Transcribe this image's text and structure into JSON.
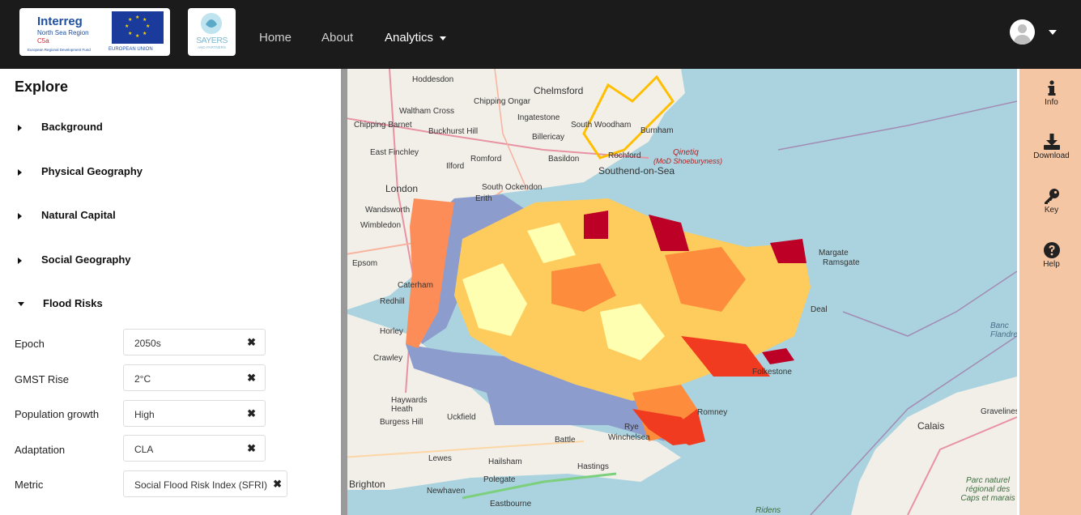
{
  "header": {
    "logo_interreg": {
      "title": "Interreg",
      "subtitle": "North Sea Region",
      "tag": "C5a",
      "fund": "European Regional Development Fund",
      "eu": "EUROPEAN UNION"
    },
    "logo_sayers": {
      "title": "SAYERS",
      "subtitle": "AND PARTNERS"
    },
    "nav": {
      "home": "Home",
      "about": "About",
      "analytics": "Analytics"
    }
  },
  "sidebar": {
    "title": "Explore",
    "sections": [
      "Background",
      "Physical Geography",
      "Natural Capital",
      "Social Geography",
      "Flood Risks"
    ],
    "filters": [
      {
        "label": "Epoch",
        "value": "2050s"
      },
      {
        "label": "GMST Rise",
        "value": "2°C"
      },
      {
        "label": "Population growth",
        "value": "High"
      },
      {
        "label": "Adaptation",
        "value": "CLA"
      },
      {
        "label": "Metric",
        "value": "Social Flood Risk Index (SFRI)"
      }
    ],
    "clear_glyph": "✖"
  },
  "map": {
    "labels": [
      "Hoddesdon",
      "Chelmsford",
      "Waltham Cross",
      "Chipping Ongar",
      "Ingatestone",
      "Chipping Barnet",
      "Buckhurst Hill",
      "South Woodham",
      "Burnham",
      "Billericay",
      "East Finchley",
      "Ilford",
      "Romford",
      "Basildon",
      "Rochford",
      "Qinetiq",
      "(MoD Shoeburyness)",
      "Southend-on-Sea",
      "London",
      "South Ockendon",
      "Erith",
      "Wandsworth",
      "Wimbledon",
      "Epsom",
      "Caterham",
      "Redhill",
      "Horley",
      "Crawley",
      "Haywards Heath",
      "Burgess Hill",
      "Uckfield",
      "Battle",
      "Winchelsea",
      "Rye",
      "Lewes",
      "Hailsham",
      "Hastings",
      "Polegate",
      "Newhaven",
      "Eastbourne",
      "Brighton",
      "Calais",
      "Gravelines",
      "Banc Flandre",
      "Parc naturel régional des Caps et marais",
      "Ridens",
      "Margate",
      "Ramsgate",
      "Deal",
      "Folkestone",
      "Romney"
    ],
    "colors": {
      "sea": "#aad3df",
      "land": "#f2efe9",
      "low": "#ffffb2",
      "mid": "#fecc5c",
      "high": "#fd8d3c",
      "higher": "#f03b20",
      "highest": "#bd0026",
      "nodata": "#8c9ccc"
    }
  },
  "tools": [
    {
      "icon": "info-icon",
      "label": "Info"
    },
    {
      "icon": "download-icon",
      "label": "Download"
    },
    {
      "icon": "key-icon",
      "label": "Key"
    },
    {
      "icon": "help-icon",
      "label": "Help"
    }
  ]
}
